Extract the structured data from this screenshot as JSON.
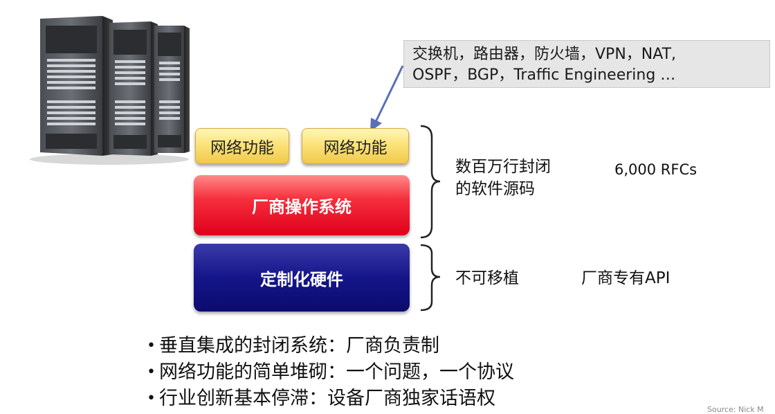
{
  "callout": {
    "line1": "交换机，路由器，防火墙，VPN，NAT,",
    "line2": "OSPF，BGP，Traffic Engineering …"
  },
  "boxes": {
    "network_function_1": "网络功能",
    "network_function_2": "网络功能",
    "vendor_os": "厂商操作系统",
    "custom_hardware": "定制化硬件"
  },
  "annotations": {
    "closed_source_line1": "数百万行封闭",
    "closed_source_line2": "的软件源码",
    "rfcs": "6,000 RFCs",
    "not_portable": "不可移植",
    "vendor_api": "厂商专有API"
  },
  "bullets": [
    "垂直集成的封闭系统：厂商负责制",
    "网络功能的简单堆砌：一个问题，一个协议",
    "行业创新基本停滞：设备厂商独家话语权"
  ],
  "source": "Source: Nick M",
  "colors": {
    "yellow_box": "#fbe37a",
    "red_box": "#e0001c",
    "blue_box": "#15158a",
    "callout_bg": "#e6e6e6",
    "arrow": "#5a6fb8"
  },
  "icons": {
    "servers": "server-rack-image"
  }
}
